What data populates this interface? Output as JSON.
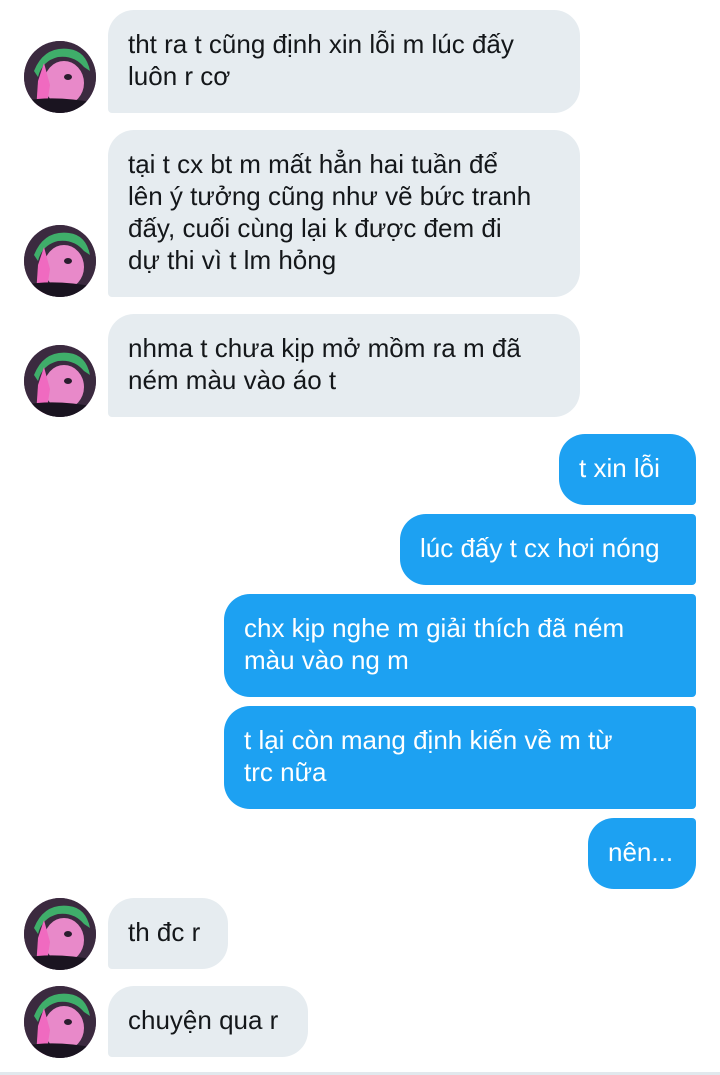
{
  "messages": [
    {
      "side": "received",
      "lines": [
        "tht ra t cũng định xin lỗi m lúc đấy",
        "luôn r cơ"
      ]
    },
    {
      "side": "received",
      "lines": [
        "tại t cx bt m mất hẳn hai tuần để",
        "lên ý tưởng cũng như vẽ bức tranh",
        "đấy, cuối cùng lại k được đem đi",
        "dự thi vì t lm hỏng"
      ]
    },
    {
      "side": "received",
      "lines": [
        "nhma t chưa kịp mở mồm ra m đã",
        "ném màu vào áo t"
      ]
    },
    {
      "side": "sent",
      "lines": [
        "t xin lỗi"
      ]
    },
    {
      "side": "sent",
      "lines": [
        "lúc đấy t cx hơi nóng"
      ]
    },
    {
      "side": "sent",
      "lines": [
        "chx kịp nghe m giải thích đã ném",
        "màu vào ng m"
      ]
    },
    {
      "side": "sent",
      "lines": [
        "t lại còn mang định kiến về m từ",
        "trc nữa"
      ]
    },
    {
      "side": "sent",
      "lines": [
        "nên..."
      ]
    },
    {
      "side": "received",
      "lines": [
        "th đc r"
      ]
    },
    {
      "side": "received",
      "lines": [
        "chuyện qua r"
      ]
    }
  ],
  "avatar_icon": "profile-photo-pink-face-green-hair",
  "colors": {
    "received_bubble": "#e6ecf0",
    "received_text": "#14171a",
    "sent_bubble": "#1da1f2",
    "sent_text": "#ffffff",
    "background": "#ffffff"
  }
}
